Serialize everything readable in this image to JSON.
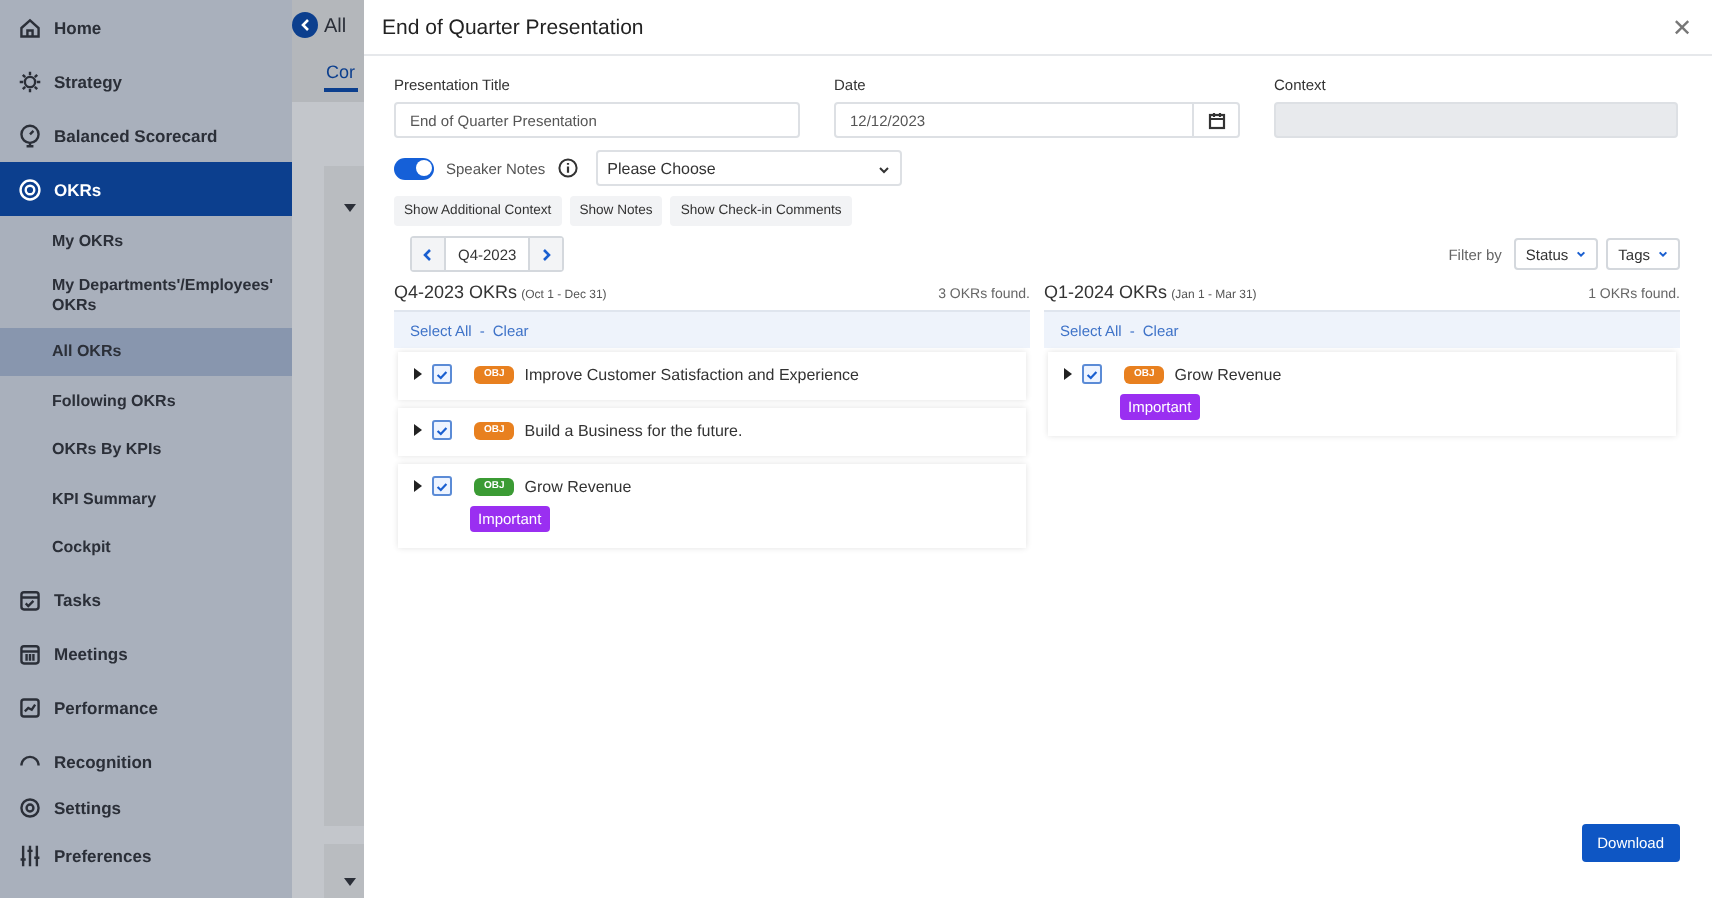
{
  "sidebar": {
    "items": [
      {
        "label": "Home",
        "selected": false
      },
      {
        "label": "Strategy",
        "selected": false
      },
      {
        "label": "Balanced Scorecard",
        "selected": false
      },
      {
        "label": "OKRs",
        "selected": true,
        "children": [
          {
            "label": "My OKRs",
            "selected": false
          },
          {
            "label": "My Departments'/Employees' OKRs",
            "selected": false
          },
          {
            "label": "All OKRs",
            "selected": true
          },
          {
            "label": "Following OKRs",
            "selected": false
          },
          {
            "label": "OKRs By KPIs",
            "selected": false
          },
          {
            "label": "KPI Summary",
            "selected": false
          },
          {
            "label": "Cockpit",
            "selected": false
          }
        ]
      },
      {
        "label": "Tasks",
        "selected": false
      },
      {
        "label": "Meetings",
        "selected": false
      },
      {
        "label": "Performance",
        "selected": false
      },
      {
        "label": "Recognition",
        "selected": false
      },
      {
        "label": "Settings",
        "selected": false
      },
      {
        "label": "Preferences",
        "selected": false
      }
    ]
  },
  "background_page": {
    "title": "All",
    "tab": "Cor"
  },
  "dialog": {
    "title": "End of Quarter Presentation",
    "close": "✕",
    "fields": [
      {
        "label": "Presentation Title",
        "value": "End of Quarter Presentation",
        "kind": "text"
      },
      {
        "label": "Date",
        "value": "12/12/2023",
        "kind": "date"
      },
      {
        "label": "Context",
        "kind": "disabled"
      }
    ],
    "speaker_notes": {
      "label": "Speaker Notes",
      "on": true
    },
    "select": {
      "placeholder": "Please Choose"
    },
    "toggles": [
      "Show Additional Context",
      "Show Notes",
      "Show Check-in Comments"
    ],
    "quarter": "Q4-2023",
    "filter": {
      "label": "Filter by",
      "buttons": [
        "Status",
        "Tags"
      ]
    },
    "columns": [
      {
        "title": "Q4-2023 OKRs",
        "range": "(Oct 1 - Dec 31)",
        "count": "3 OKRs found.",
        "select_all": "Select All",
        "separator": "-",
        "clear": "Clear",
        "okrs": [
          {
            "badge": "OBJ",
            "color": "#e8801f",
            "title": "Improve Customer Satisfaction and Experience",
            "checked": true
          },
          {
            "badge": "OBJ",
            "color": "#e8801f",
            "title": "Build a Business for the future.",
            "checked": true
          },
          {
            "badge": "OBJ",
            "color": "#3b9b34",
            "title": "Grow Revenue",
            "checked": true,
            "tags": [
              "Important"
            ]
          }
        ]
      },
      {
        "title": "Q1-2024 OKRs",
        "range": "(Jan 1 - Mar 31)",
        "count": "1 OKRs found.",
        "select_all": "Select All",
        "separator": "-",
        "clear": "Clear",
        "okrs": [
          {
            "badge": "OBJ",
            "color": "#e8801f",
            "title": "Grow Revenue",
            "checked": true,
            "tags": [
              "Important"
            ]
          }
        ]
      }
    ],
    "download": "Download"
  }
}
